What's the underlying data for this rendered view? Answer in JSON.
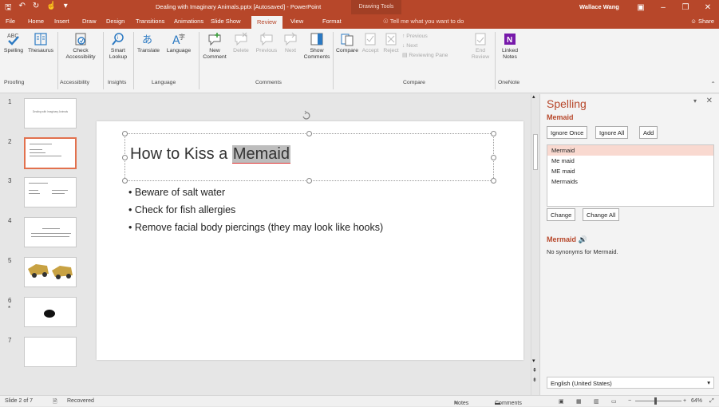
{
  "titlebar": {
    "doc_title": "Dealing with Imaginary Animals.pptx [Autosaved]  -  PowerPoint",
    "context_tab": "Drawing Tools",
    "user": "Wallace Wang",
    "qat": [
      "save-icon",
      "undo-icon",
      "redo-icon",
      "touch-mode-icon",
      "customize-icon"
    ]
  },
  "tabs": [
    "File",
    "Home",
    "Insert",
    "Draw",
    "Design",
    "Transitions",
    "Animations",
    "Slide Show",
    "Review",
    "View",
    "Format"
  ],
  "active_tab": "Review",
  "tell_me": "Tell me what you want to do",
  "share": "Share",
  "ribbon": {
    "buttons": {
      "spelling": "Spelling",
      "thesaurus": "Thesaurus",
      "check_access": "Check Accessibility",
      "smart_lookup": "Smart Lookup",
      "translate": "Translate",
      "language": "Language",
      "new_comment": "New Comment",
      "delete": "Delete",
      "previous": "Previous",
      "next": "Next",
      "show_comments": "Show Comments",
      "compare": "Compare",
      "accept": "Accept",
      "reject": "Reject",
      "prev2": "Previous",
      "next2": "Next",
      "reviewing_pane": "Reviewing Pane",
      "end_review": "End Review",
      "linked_notes": "Linked Notes"
    },
    "groups": [
      "Proofing",
      "Accessibility",
      "Insights",
      "Language",
      "Comments",
      "Compare",
      "OneNote"
    ]
  },
  "slides": {
    "numbers": [
      "1",
      "2",
      "3",
      "4",
      "5",
      "6",
      "7"
    ],
    "selected": "2",
    "slide6_marker": "*",
    "slide1_title": "Dealing with Imaginary Animals"
  },
  "slide": {
    "title_prefix": "How to Kiss a ",
    "title_misspelled": "Memaid",
    "bullets": [
      "Beware of salt water",
      "Check for fish allergies",
      "Remove facial body piercings (they may look like hooks)"
    ]
  },
  "spelling": {
    "header": "Spelling",
    "word": "Memaid",
    "ignore_once": "Ignore Once",
    "ignore_all": "Ignore All",
    "add": "Add",
    "suggestions": [
      "Mermaid",
      "Me maid",
      "ME maid",
      "Mermaids"
    ],
    "change": "Change",
    "change_all": "Change All",
    "syn_word": "Mermaid",
    "syn_text": "No synonyms for Mermaid.",
    "language": "English (United States)"
  },
  "status": {
    "slide_info": "Slide 2 of 7",
    "recovered": "Recovered",
    "notes": "Notes",
    "comments": "Comments",
    "zoom": "64%"
  }
}
